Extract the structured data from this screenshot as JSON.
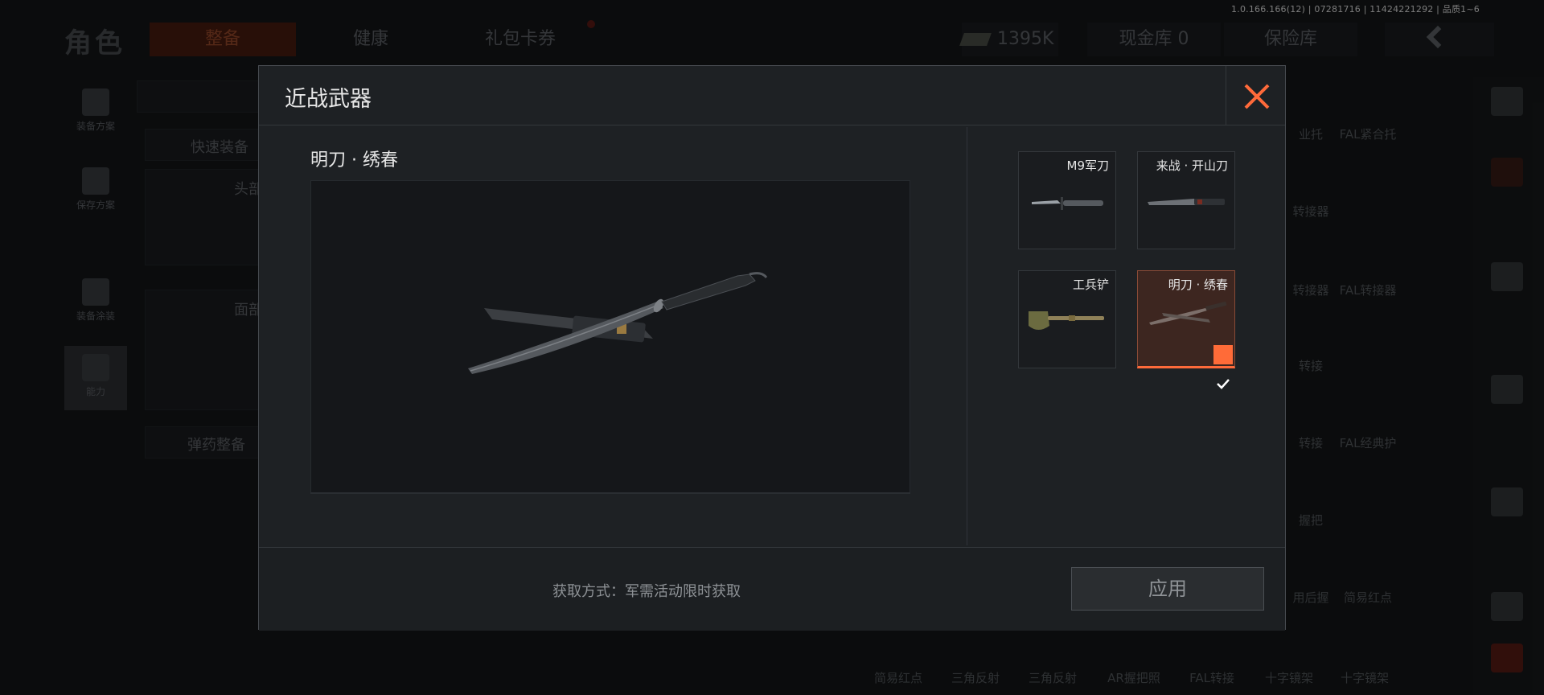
{
  "version": "1.0.166.166(12) | 07281716 | 11424221292 | 品质1~6",
  "background": {
    "page_title": "角色",
    "tabs": [
      {
        "label": "整备",
        "active": true
      },
      {
        "label": "健康",
        "active": false
      },
      {
        "label": "礼包卡券",
        "active": false
      }
    ],
    "cash": "1395K",
    "cash_vault": "现金库 0",
    "insurance": "保险库",
    "side_buttons": [
      "装备方案",
      "保存方案",
      "装备涂装",
      "能力"
    ],
    "quick_equip": "快速装备",
    "ammo_equip": "弹药整备",
    "head_label": "头部",
    "face_label": "面部",
    "right_grid_labels": [
      "业托",
      "FAL紧合托",
      "转接器",
      "转接器",
      "FAL转接器",
      "转接",
      "转接",
      "FAL经典护",
      "握把",
      "用后握",
      "简易红点"
    ],
    "bottom_labels": [
      "简易红点",
      "三角反射",
      "三角反射",
      "AR握把照",
      "FAL转接",
      "十字镜架",
      "十字镜架"
    ]
  },
  "dialog": {
    "title": "近战武器",
    "selected_name": "明刀 · 绣春",
    "acquire_text": "获取方式：军需活动限时获取",
    "apply_label": "应用",
    "weapons": [
      {
        "name": "M9军刀",
        "icon": "combat-knife-icon",
        "selected": false
      },
      {
        "name": "来战 · 开山刀",
        "icon": "machete-icon",
        "selected": false
      },
      {
        "name": "工兵铲",
        "icon": "shovel-icon",
        "selected": false
      },
      {
        "name": "明刀 · 绣春",
        "icon": "saber-icon",
        "selected": true
      }
    ]
  },
  "colors": {
    "accent": "#ff6b38",
    "close": "#ff6a3a",
    "selected_card_bg": "#3d2620"
  }
}
